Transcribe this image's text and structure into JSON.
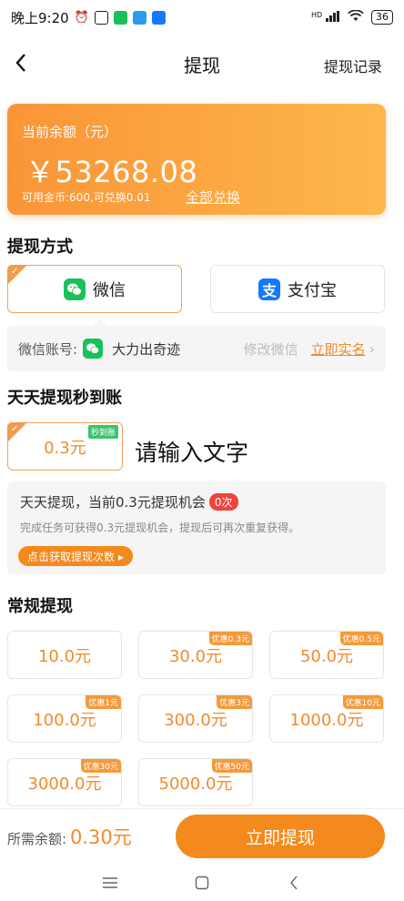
{
  "status_bar": {
    "time": "晚上9:20",
    "network": "HD",
    "battery": "36"
  },
  "nav": {
    "title": "提现",
    "right_link": "提现记录"
  },
  "balance": {
    "label": "当前余额（元）",
    "value": "￥53268.08",
    "sub": "可用金币:600,可兑换0.01",
    "exchange_link": "全部兑换"
  },
  "method_section": {
    "title": "提现方式",
    "options": [
      {
        "label": "微信",
        "icon": "wechat-icon",
        "selected": true
      },
      {
        "label": "支付宝",
        "icon": "alipay-icon",
        "selected": false
      }
    ],
    "account": {
      "label": "微信账号:",
      "name": "大力出奇迹",
      "edit": "修改微信",
      "realname": "立即实名"
    }
  },
  "daily_section": {
    "title": "天天提现秒到账",
    "amount": "0.3元",
    "tag": "秒到账",
    "placeholder": "请输入文字",
    "info_title": "天天提现，当前0.3元提现机会",
    "info_badge": "0次",
    "info_desc": "完成任务可获得0.3元提现机会，提现后可再次重复获得。",
    "get_button": "点击获取提现次数 ▸"
  },
  "regular_section": {
    "title": "常规提现",
    "amounts": [
      {
        "label": "10.0元",
        "tag": ""
      },
      {
        "label": "30.0元",
        "tag": "优惠0.3元"
      },
      {
        "label": "50.0元",
        "tag": "优惠0.5元"
      },
      {
        "label": "100.0元",
        "tag": "优惠1元"
      },
      {
        "label": "300.0元",
        "tag": "优惠3元"
      },
      {
        "label": "1000.0元",
        "tag": "优惠10元"
      },
      {
        "label": "3000.0元",
        "tag": "优惠30元"
      },
      {
        "label": "5000.0元",
        "tag": "优惠50元"
      }
    ]
  },
  "bottom": {
    "need_label": "所需余额:",
    "need_value": "0.30元",
    "submit": "立即提现"
  },
  "colors": {
    "accent": "#f4891d",
    "wechat": "#19c15b",
    "alipay": "#1677ff"
  }
}
